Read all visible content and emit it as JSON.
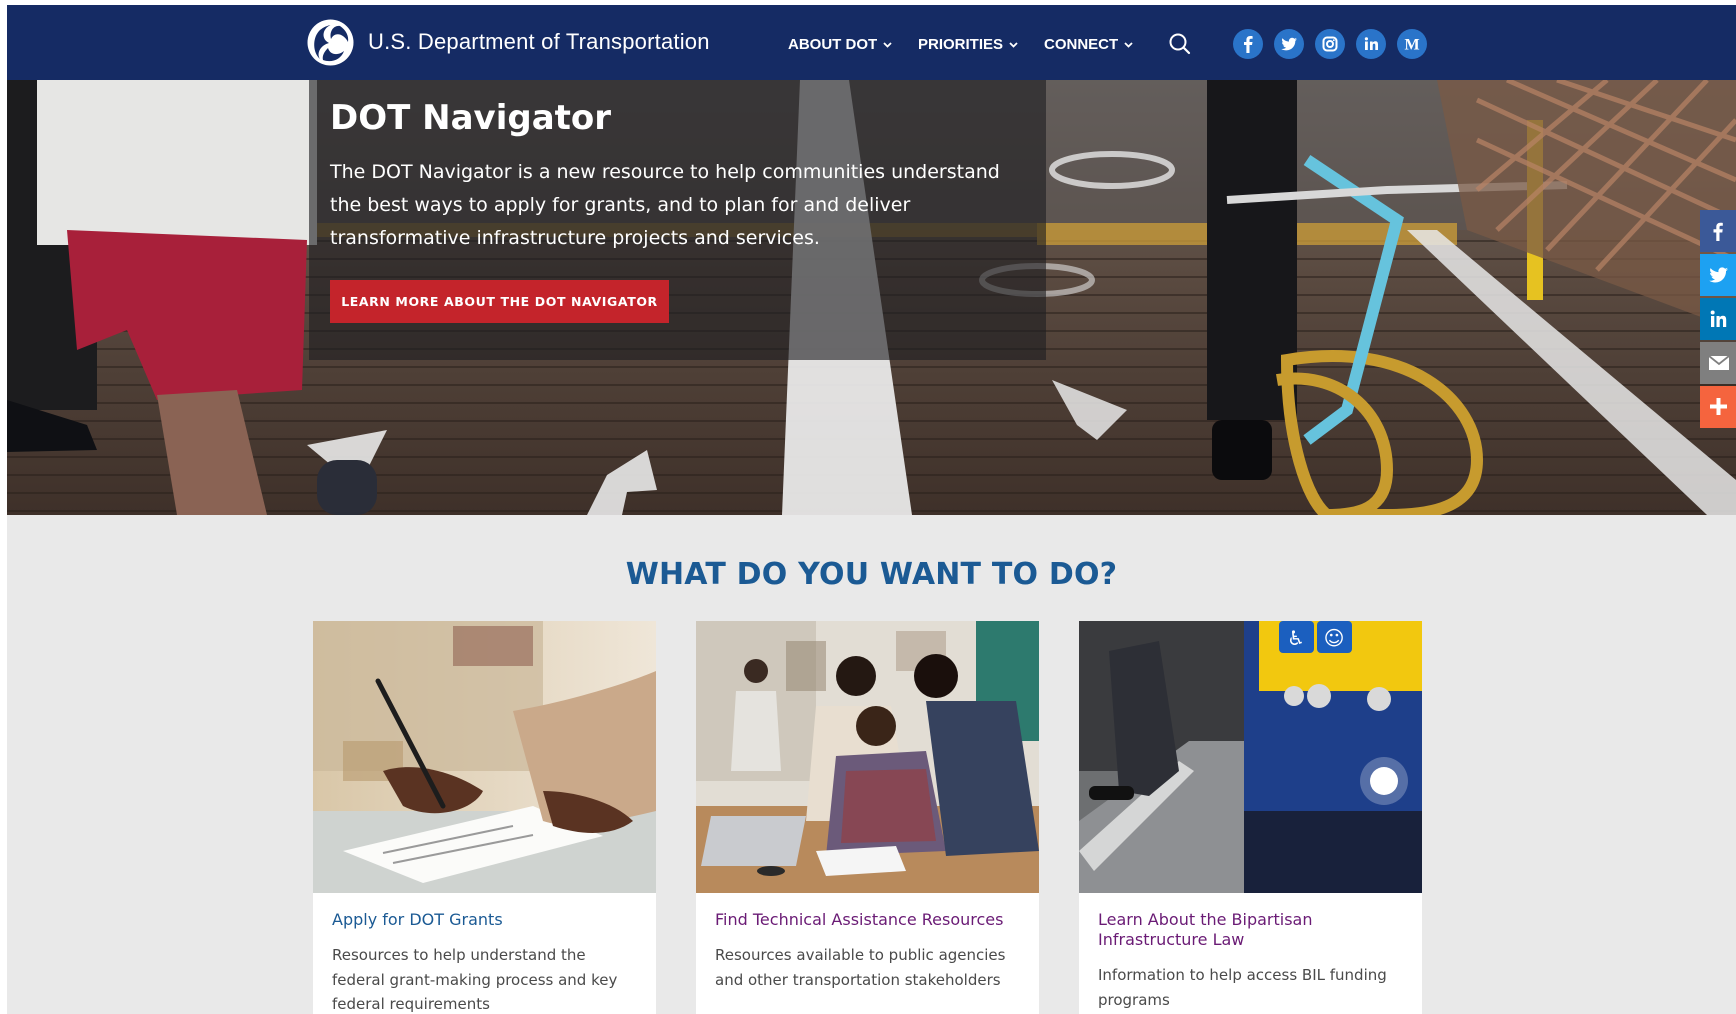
{
  "header": {
    "site_title": "U.S. Department of Transportation",
    "nav": [
      {
        "label": "ABOUT DOT"
      },
      {
        "label": "PRIORITIES"
      },
      {
        "label": "CONNECT"
      }
    ],
    "social": [
      "facebook-icon",
      "twitter-icon",
      "instagram-icon",
      "linkedin-icon",
      "medium-icon"
    ]
  },
  "hero": {
    "title": "DOT Navigator",
    "text": "The DOT Navigator is a new resource to help communities understand the best ways to apply for grants, and to plan for and deliver transformative infrastructure projects and services.",
    "cta": "LEARN MORE ABOUT THE DOT NAVIGATOR"
  },
  "share_bar": [
    "facebook-icon",
    "twitter-icon",
    "linkedin-icon",
    "email-icon",
    "plus-icon"
  ],
  "main": {
    "section_title": "WHAT DO YOU WANT TO DO?",
    "cards": [
      {
        "title": "Apply for DOT Grants",
        "description": "Resources to help understand the federal grant-making process and key federal requirements"
      },
      {
        "title": "Find Technical Assistance Resources",
        "description": "Resources available to public agencies and other transportation stakeholders"
      },
      {
        "title": "Learn About the Bipartisan Infrastructure Law",
        "description": "Information to help access BIL funding programs"
      }
    ]
  },
  "colors": {
    "header_bg": "#152b64",
    "accent_blue": "#1b5a94",
    "cta_red": "#c4242b",
    "link_visited": "#6a1b75",
    "social_blue": "#2a74c9",
    "page_bg": "#e9e9e9"
  }
}
